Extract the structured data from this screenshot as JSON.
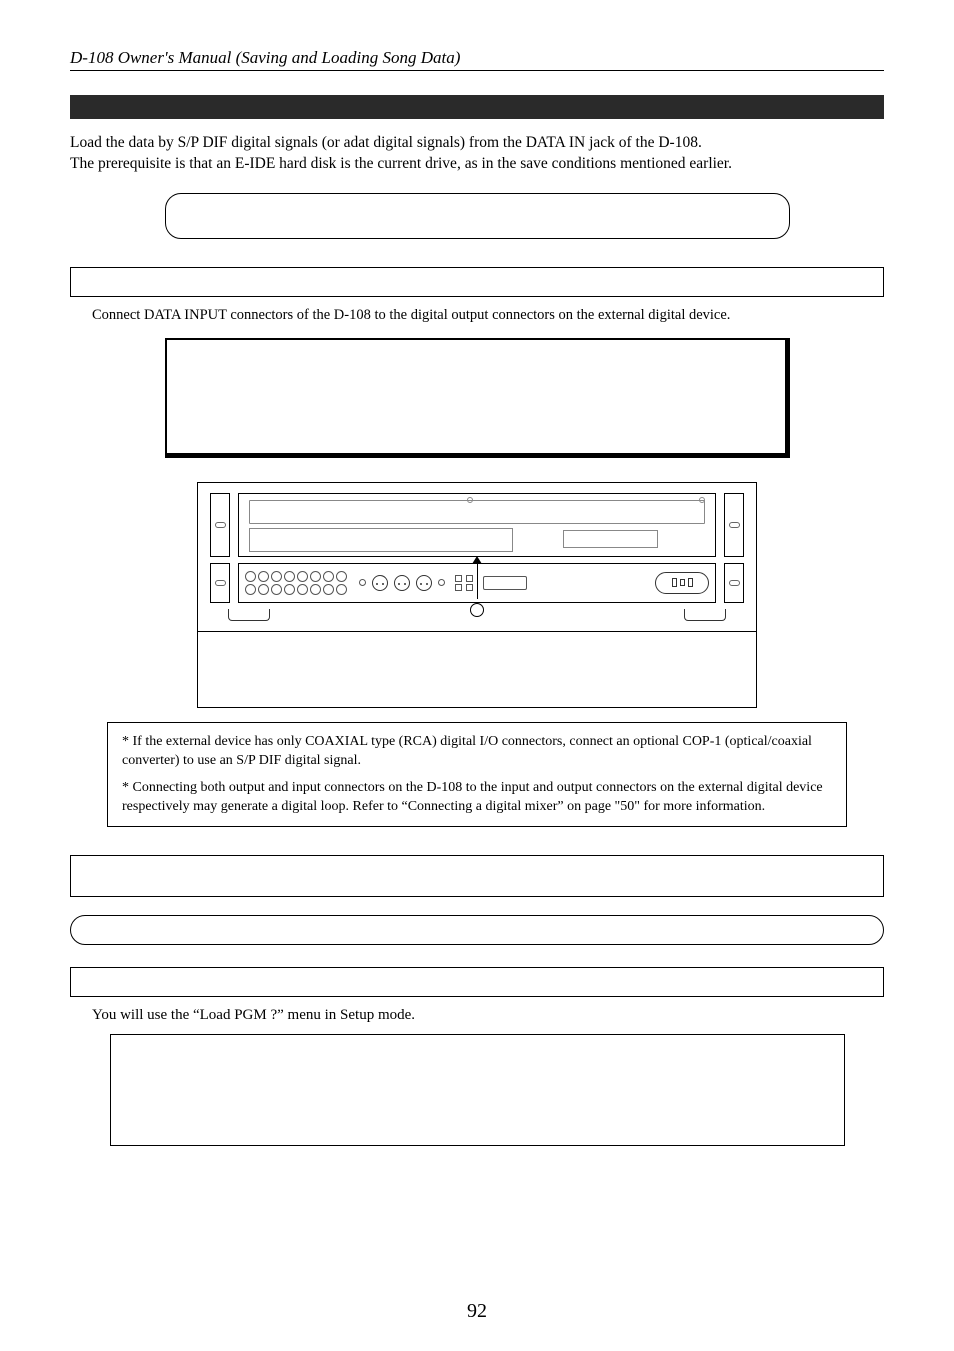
{
  "header": {
    "title": "D-108 Owner's Manual (Saving and Loading Song Data)"
  },
  "intro": {
    "line1": "Load the data by S/P DIF digital signals (or adat digital signals) from the DATA IN jack of the D-108.",
    "line2": "The prerequisite is that an E-IDE hard disk is the current drive, as in the save conditions mentioned earlier."
  },
  "connect_instruction": "Connect DATA INPUT connectors of the D-108 to the digital output connectors on the external digital device.",
  "notes": {
    "n1": "* If the external device has only COAXIAL type (RCA) digital I/O connectors, connect an optional COP-1 (optical/coaxial converter) to use an S/P DIF digital signal.",
    "n2": "* Connecting both output and input connectors on the D-108 to the input and output  connectors on the external digital device respectively may generate a digital loop. Refer to “Connecting a digital mixer” on page \"50\" for more information."
  },
  "setup_note": "You will use the “Load PGM ?” menu in Setup mode.",
  "page_number": "92"
}
